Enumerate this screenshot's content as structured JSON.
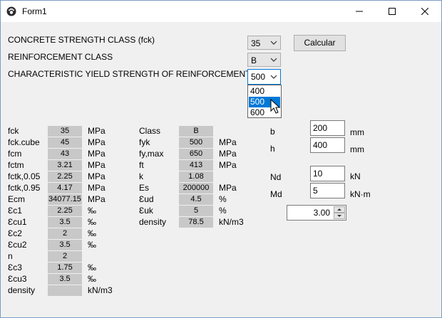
{
  "window": {
    "title": "Form1"
  },
  "form": {
    "concrete_label": "CONCRETE STRENGTH CLASS (fck)",
    "reinforcement_label": "REINFORCEMENT CLASS",
    "fyk_label": "CHARACTERISTIC YIELD STRENGTH OF REINFORCEMENT (fyk)",
    "concrete_value": "35",
    "reinforcement_value": "B",
    "fyk_value": "500",
    "fyk_options": [
      "400",
      "500",
      "600"
    ],
    "fyk_selected_index": 1,
    "calc_button": "Calcular"
  },
  "concrete": [
    {
      "label": "fck",
      "value": "35",
      "unit": "MPa"
    },
    {
      "label": "fck.cube",
      "value": "45",
      "unit": "MPa"
    },
    {
      "label": "fcm",
      "value": "43",
      "unit": "MPa"
    },
    {
      "label": "fctm",
      "value": "3.21",
      "unit": "MPa"
    },
    {
      "label": "fctk,0.05",
      "value": "2.25",
      "unit": "MPa"
    },
    {
      "label": "fctk,0.95",
      "value": "4.17",
      "unit": "MPa"
    },
    {
      "label": "Ecm",
      "value": "34077.15",
      "unit": "MPa"
    },
    {
      "label": "Ɛc1",
      "value": "2.25",
      "unit": "‰"
    },
    {
      "label": "Ɛcu1",
      "value": "3.5",
      "unit": "‰"
    },
    {
      "label": "Ɛc2",
      "value": "2",
      "unit": "‰"
    },
    {
      "label": "Ɛcu2",
      "value": "3.5",
      "unit": "‰"
    },
    {
      "label": "n",
      "value": "2",
      "unit": ""
    },
    {
      "label": "Ɛc3",
      "value": "1.75",
      "unit": "‰"
    },
    {
      "label": "Ɛcu3",
      "value": "3.5",
      "unit": "‰"
    },
    {
      "label": "density",
      "value": "",
      "unit": "kN/m3"
    }
  ],
  "steel": [
    {
      "label": "Class",
      "value": "B",
      "unit": ""
    },
    {
      "label": "fyk",
      "value": "500",
      "unit": "MPa"
    },
    {
      "label": "fy,max",
      "value": "650",
      "unit": "MPa"
    },
    {
      "label": "ft",
      "value": "413",
      "unit": "MPa"
    },
    {
      "label": "k",
      "value": "1.08",
      "unit": ""
    },
    {
      "label": "Es",
      "value": "200000",
      "unit": "MPa"
    },
    {
      "label": "Ɛud",
      "value": "4.5",
      "unit": "%"
    },
    {
      "label": "Ɛuk",
      "value": "5",
      "unit": "%"
    },
    {
      "label": "density",
      "value": "78.5",
      "unit": "kN/m3"
    }
  ],
  "section": {
    "b_label": "b",
    "b_value": "200",
    "b_unit": "mm",
    "h_label": "h",
    "h_value": "400",
    "h_unit": "mm",
    "nd_label": "Nd",
    "nd_value": "10",
    "nd_unit": "kN",
    "md_label": "Md",
    "md_value": "5",
    "md_unit": "kN·m",
    "spin_value": "3.00"
  }
}
